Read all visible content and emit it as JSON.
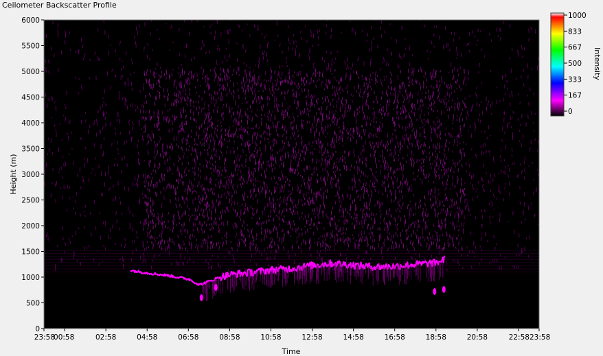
{
  "window": {
    "title": "Ceilometer Backscatter Profile"
  },
  "chart_data": {
    "type": "heatmap",
    "title": "Ceilometer Backscatter Profile",
    "xlabel": "Time",
    "ylabel": "Height (m)",
    "x_ticks": [
      "23:58",
      "00:58",
      "02:58",
      "04:58",
      "06:58",
      "08:58",
      "10:58",
      "12:58",
      "14:58",
      "16:58",
      "18:58",
      "20:58",
      "22:58",
      "23:58"
    ],
    "x_tick_hours": [
      -0.0333,
      0.9667,
      2.9667,
      4.9667,
      6.9667,
      8.9667,
      10.9667,
      12.9667,
      14.9667,
      16.9667,
      18.9667,
      20.9667,
      22.9667,
      23.9667
    ],
    "xlim_hours": [
      -0.0333,
      23.9667
    ],
    "ylim": [
      0,
      6000
    ],
    "y_ticks": [
      0,
      500,
      1000,
      1500,
      2000,
      2500,
      3000,
      3500,
      4000,
      4500,
      5000,
      5500,
      6000
    ],
    "colorbar": {
      "label": "Intensity",
      "range": [
        0,
        1000
      ],
      "ticks": [
        0,
        167,
        333,
        500,
        667,
        833,
        1000
      ],
      "colors": [
        "#000000",
        "#ff00ff",
        "#0000ff",
        "#00ffff",
        "#00ff00",
        "#ffff00",
        "#ff0000",
        "#ffffff"
      ]
    },
    "cloud_layer": {
      "intensity": 200,
      "time_hours": [
        4.15,
        5.0,
        6.0,
        7.0,
        7.5,
        8.0,
        8.5,
        9.0,
        10.0,
        11.0,
        12.0,
        13.0,
        14.0,
        15.0,
        16.0,
        17.0,
        18.0,
        19.0,
        19.4
      ],
      "height_m": [
        1130,
        1080,
        1030,
        960,
        850,
        920,
        1000,
        1050,
        1090,
        1140,
        1170,
        1230,
        1270,
        1230,
        1200,
        1210,
        1250,
        1280,
        1350
      ]
    },
    "noise_band": {
      "intensity": 120,
      "height_range_m": [
        1500,
        6000
      ]
    }
  }
}
